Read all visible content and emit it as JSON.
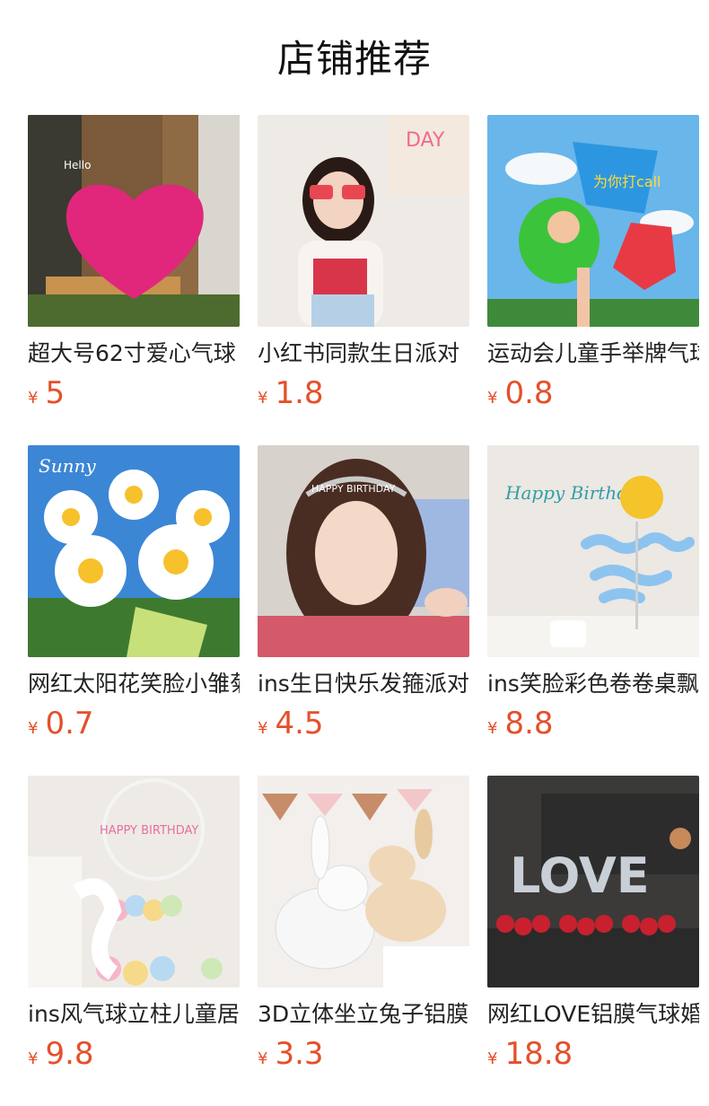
{
  "header": {
    "title": "店铺推荐"
  },
  "products": [
    {
      "name": "超大号62寸爱心气球",
      "currency": "¥",
      "price": "5",
      "image_text": "Hello"
    },
    {
      "name": "小红书同款生日派对",
      "currency": "¥",
      "price": "1.8",
      "image_text": "DAY"
    },
    {
      "name": "运动会儿童手举牌气球",
      "currency": "¥",
      "price": "0.8",
      "image_text": "为你打call"
    },
    {
      "name": "网红太阳花笑脸小雏菊",
      "currency": "¥",
      "price": "0.7",
      "image_text": "Sunny"
    },
    {
      "name": "ins生日快乐发箍派对",
      "currency": "¥",
      "price": "4.5",
      "image_text": "HAPPY BIRTHDAY"
    },
    {
      "name": "ins笑脸彩色卷卷桌飘",
      "currency": "¥",
      "price": "8.8",
      "image_text": "Happy Birthday"
    },
    {
      "name": "ins风气球立柱儿童居",
      "currency": "¥",
      "price": "9.8",
      "image_text": "HAPPY BIRTHDAY"
    },
    {
      "name": "3D立体坐立兔子铝膜",
      "currency": "¥",
      "price": "3.3",
      "image_text": ""
    },
    {
      "name": "网红LOVE铝膜气球婚",
      "currency": "¥",
      "price": "18.8",
      "image_text": "LOVE"
    }
  ]
}
